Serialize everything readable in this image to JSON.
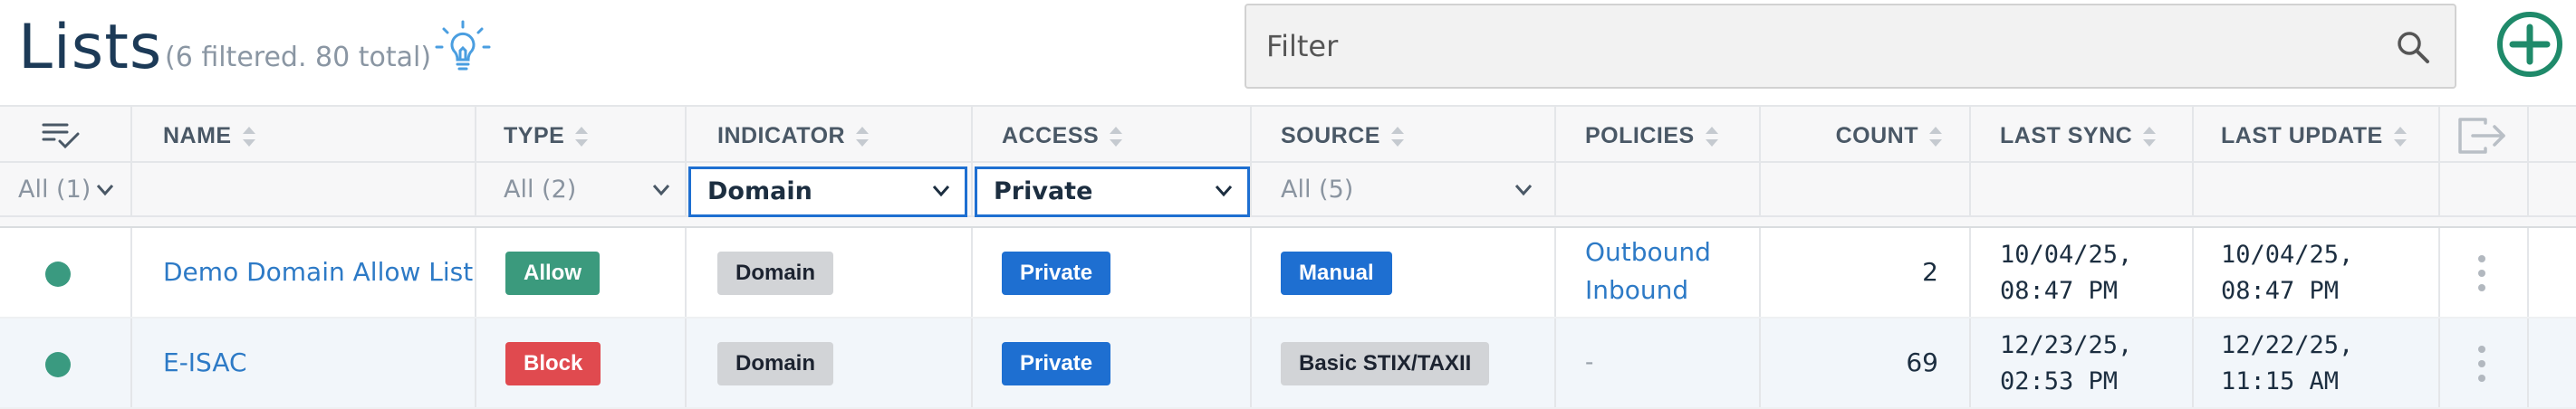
{
  "header": {
    "title": "Lists",
    "subtitle": "(6 filtered. 80 total)",
    "filter_placeholder": "Filter"
  },
  "colors": {
    "accent": "#1e6fd1",
    "allow": "#3b9a7d",
    "block": "#e04a4f",
    "add": "#1f8a6a",
    "link": "#2d7ac6"
  },
  "columns": {
    "name": "NAME",
    "type": "TYPE",
    "indicator": "INDICATOR",
    "access": "ACCESS",
    "source": "SOURCE",
    "policies": "POLICIES",
    "count": "COUNT",
    "last_sync": "LAST SYNC",
    "last_update": "LAST UPDATE"
  },
  "filters": {
    "status": "All (1)",
    "type": "All (2)",
    "indicator": "Domain",
    "access": "Private",
    "source": "All (5)"
  },
  "rows": [
    {
      "name": "Demo Domain Allow List",
      "type": "Allow",
      "indicator": "Domain",
      "access": "Private",
      "source": "Manual",
      "policies": [
        "Outbound",
        "Inbound"
      ],
      "count": "2",
      "last_sync": "10/04/25,\n08:47 PM",
      "last_update": "10/04/25,\n08:47 PM"
    },
    {
      "name": "E-ISAC",
      "type": "Block",
      "indicator": "Domain",
      "access": "Private",
      "source": "Basic STIX/TAXII",
      "policies_empty": "-",
      "count": "69",
      "last_sync": "12/23/25,\n02:53 PM",
      "last_update": "12/22/25,\n11:15 AM"
    }
  ]
}
